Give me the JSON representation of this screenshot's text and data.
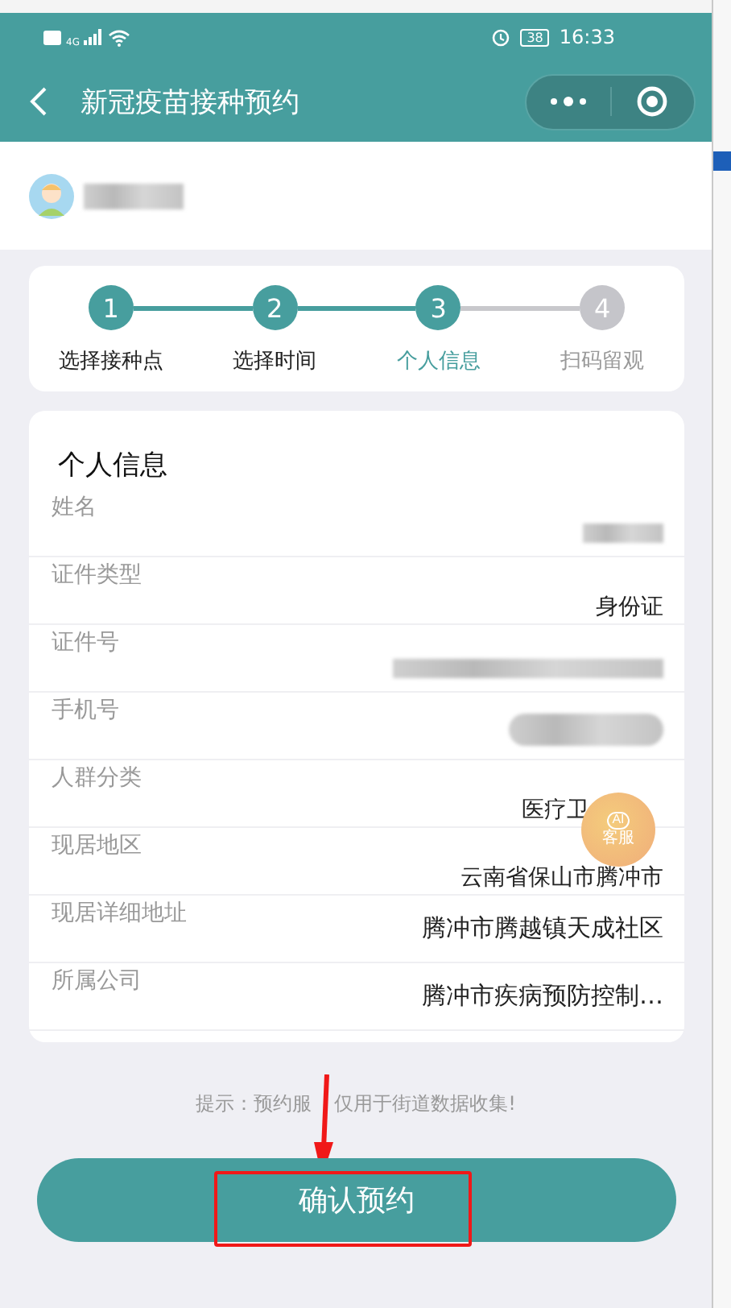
{
  "status_bar": {
    "network": "4G",
    "battery": "38",
    "time": "16:33"
  },
  "nav": {
    "title": "新冠疫苗接种预约"
  },
  "user": {
    "name_blurred": true
  },
  "steps": [
    {
      "number": "1",
      "label": "选择接种点",
      "done": true,
      "selected": false
    },
    {
      "number": "2",
      "label": "选择时间",
      "done": true,
      "selected": false
    },
    {
      "number": "3",
      "label": "个人信息",
      "done": true,
      "selected": true
    },
    {
      "number": "4",
      "label": "扫码留观",
      "done": false,
      "selected": false
    }
  ],
  "info": {
    "title": "个人信息",
    "fields": [
      {
        "label": "姓名",
        "kind": "blurred"
      },
      {
        "label": "证件类型",
        "kind": "text",
        "value": "身份证"
      },
      {
        "label": "证件号",
        "kind": "blurred"
      },
      {
        "label": "手机号",
        "kind": "blurred"
      },
      {
        "label": "人群分类",
        "kind": "text",
        "value": "医疗卫",
        "covered": true
      },
      {
        "label": "现居地区",
        "kind": "text",
        "value": "云南省保山市腾冲市"
      },
      {
        "label": "现居详细地址",
        "kind": "text",
        "value": "腾冲市腾越镇天成社区",
        "strong": true
      },
      {
        "label": "所属公司",
        "kind": "text",
        "value": "腾冲市疾病预防控制…",
        "strong": true
      }
    ]
  },
  "assistant": {
    "badge": "AI",
    "label": "客服"
  },
  "hint": [
    "提示：预约服",
    "仅用于街道数据收集!"
  ],
  "confirm_button": "确认预约"
}
